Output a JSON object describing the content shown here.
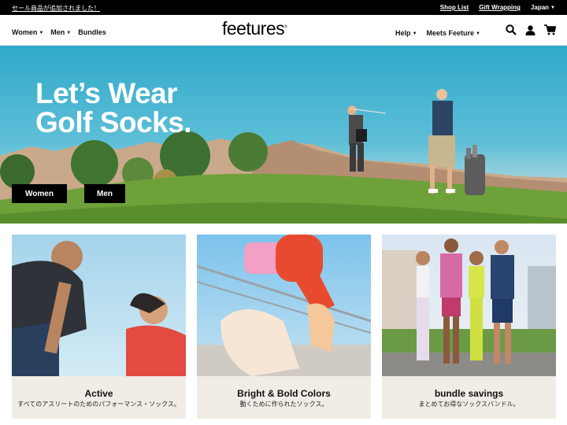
{
  "topbar": {
    "announcement": "セール商品が追加されました！",
    "shop_list": "Shop List",
    "gift_wrapping": "Gift Wrapping",
    "country": "Japan"
  },
  "header": {
    "logo": "feetures",
    "nav_left": [
      "Women",
      "Men",
      "Bundles"
    ],
    "nav_right": [
      "Help",
      "Meets Feeture"
    ],
    "icons": [
      "search-icon",
      "account-icon",
      "cart-icon"
    ]
  },
  "hero": {
    "title_line1": "Let’s Wear",
    "title_line2": "Golf Socks.",
    "button_women": "Women",
    "button_men": "Men"
  },
  "cards": [
    {
      "title": "Active",
      "subtitle": "すべてのアスリートのためのパフォーマンス・ソックス。"
    },
    {
      "title": "Bright & Bold Colors",
      "subtitle": "動くために作られたソックス。"
    },
    {
      "title": "bundle savings",
      "subtitle": "まとめてお得なソックスバンドル。"
    }
  ]
}
